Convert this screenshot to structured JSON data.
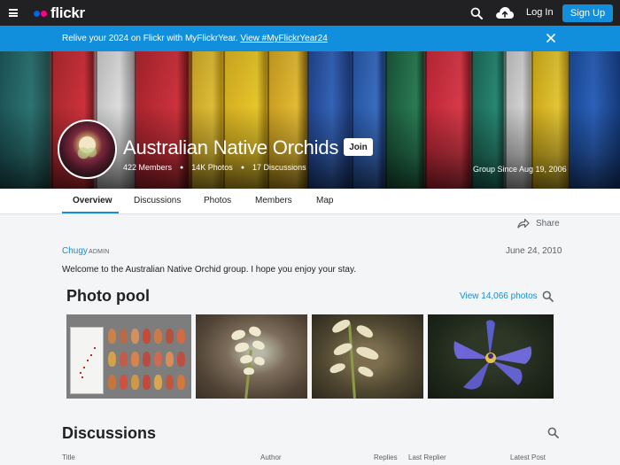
{
  "nav": {
    "logo": "flickr",
    "login": "Log In",
    "signup": "Sign Up"
  },
  "banner": {
    "text": "Relive your 2024 on Flickr with MyFlickrYear.",
    "link": "View #MyFlickrYear24"
  },
  "group": {
    "name": "Australian Native Orchids",
    "join": "Join",
    "members": "422 Members",
    "photos": "14K Photos",
    "discussions": "17 Discussions",
    "since": "Group Since Aug 19, 2006"
  },
  "tabs": [
    {
      "label": "Overview"
    },
    {
      "label": "Discussions"
    },
    {
      "label": "Photos"
    },
    {
      "label": "Members"
    },
    {
      "label": "Map"
    }
  ],
  "share": "Share",
  "post": {
    "author": "Chugy",
    "role": "ADMIN",
    "date": "June 24, 2010",
    "text": "Welcome to the Australian Native Orchid group. I hope you enjoy your stay."
  },
  "pool": {
    "title": "Photo pool",
    "view_all": "View 14,066 photos"
  },
  "discussions": {
    "title": "Discussions",
    "columns": [
      "Title",
      "Author",
      "Replies",
      "Last Replier",
      "Latest Post"
    ]
  },
  "colors": {
    "accent": "#128fdc",
    "nav_bg": "#212124",
    "logo_blue": "#0063dc",
    "logo_pink": "#ff0084"
  },
  "icons": [
    "menu-icon",
    "search-icon",
    "upload-cloud-icon",
    "close-icon",
    "share-icon"
  ]
}
